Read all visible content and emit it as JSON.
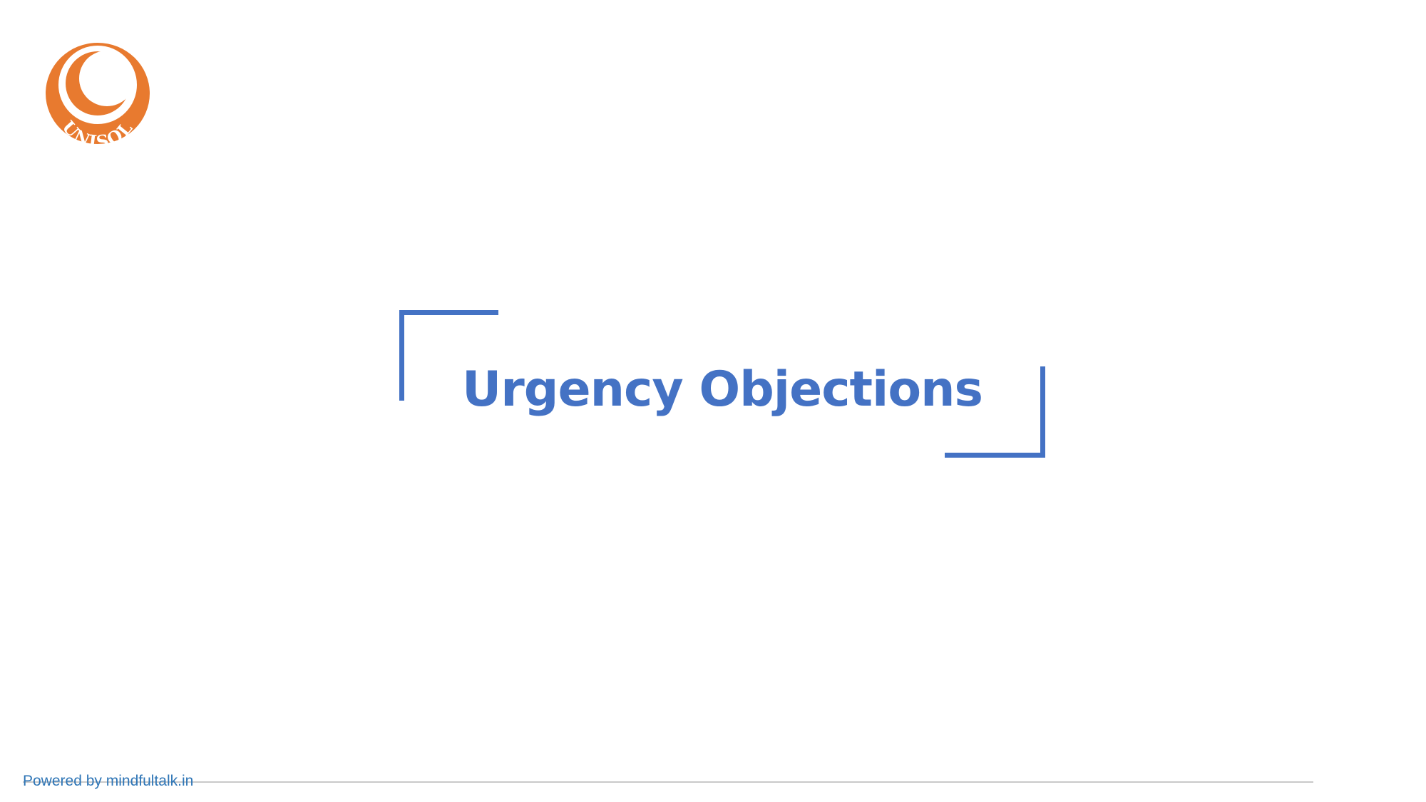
{
  "logo": {
    "text": "UNISOL",
    "brand_color": "#e87a2f",
    "icon": "unisol-crescent-logo"
  },
  "slide": {
    "title": "Urgency Objections",
    "accent_color": "#4472c4"
  },
  "footer": {
    "text": "Powered by mindfultalk.in",
    "text_color": "#2e75b6",
    "rule_color": "#c9c9c9"
  }
}
